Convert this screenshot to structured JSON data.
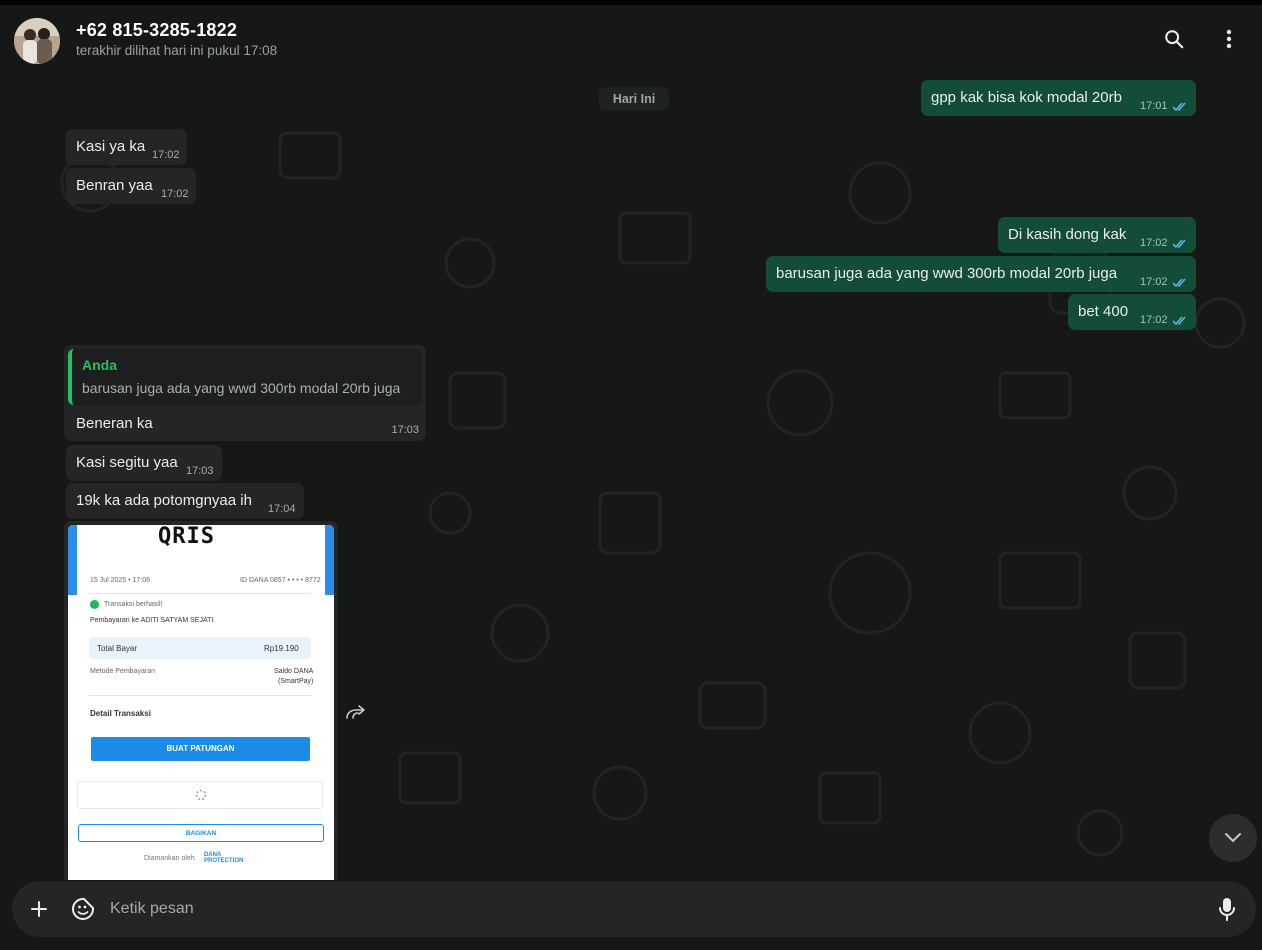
{
  "header": {
    "contact_name": "+62 815-3285-1822",
    "status": "terakhir dilihat hari ini pukul 17:08",
    "search_icon": "search-icon",
    "menu_icon": "more-vertical-icon"
  },
  "chat": {
    "date_chip": "Hari Ini",
    "messages": [
      {
        "dir": "out",
        "text": "gpp kak bisa kok modal 20rb",
        "time": "17:01",
        "status": "read"
      },
      {
        "dir": "in",
        "text": "Kasi ya ka",
        "time": "17:02"
      },
      {
        "dir": "in",
        "text": "Benran yaa",
        "time": "17:02"
      },
      {
        "dir": "out",
        "text": "Di kasih dong kak",
        "time": "17:02",
        "status": "read"
      },
      {
        "dir": "out",
        "text": "barusan juga ada yang wwd 300rb modal 20rb juga",
        "time": "17:02",
        "status": "read"
      },
      {
        "dir": "out",
        "text": "bet 400",
        "time": "17:02",
        "status": "read"
      },
      {
        "dir": "in",
        "text": "Kasi segitu yaa",
        "time": "17:03"
      },
      {
        "dir": "in",
        "text": "19k ka ada potomgnyaa ih",
        "time": "17:04"
      }
    ],
    "reply": {
      "quote_author": "Anda",
      "quote_text": "barusan juga ada yang wwd 300rb modal 20rb juga",
      "text": "Beneran ka",
      "time": "17:03"
    },
    "image_receipt": {
      "logo": "QRIS",
      "date": "15 Jul 2025 • 17:06",
      "dana_id": "ID DANA 0857 • • • • 8772",
      "success": "Transaksi berhasil!",
      "payee": "Pembayaran ke ADITI SATYAM SEJATI",
      "total_label": "Total Bayar",
      "total_value": "Rp19.190",
      "method_label": "Metode Pembayaran",
      "method_value_1": "Saldo DANA",
      "method_value_2": "(SmartPay)",
      "detail_label": "Detail Transaksi",
      "cta": "BUAT PATUNGAN",
      "share": "BAGIKAN",
      "footer": "Diamankan oleh",
      "footer_brand_1": "DANA",
      "footer_brand_2": "PROTECTION"
    }
  },
  "composer": {
    "placeholder": "Ketik pesan",
    "attach_icon": "plus-icon",
    "emoji_icon": "sticker-icon",
    "mic_icon": "mic-icon"
  },
  "colors": {
    "accent": "#21c063",
    "outgoing_bubble": "#144d37",
    "incoming_bubble": "#242626",
    "background": "#161717"
  }
}
